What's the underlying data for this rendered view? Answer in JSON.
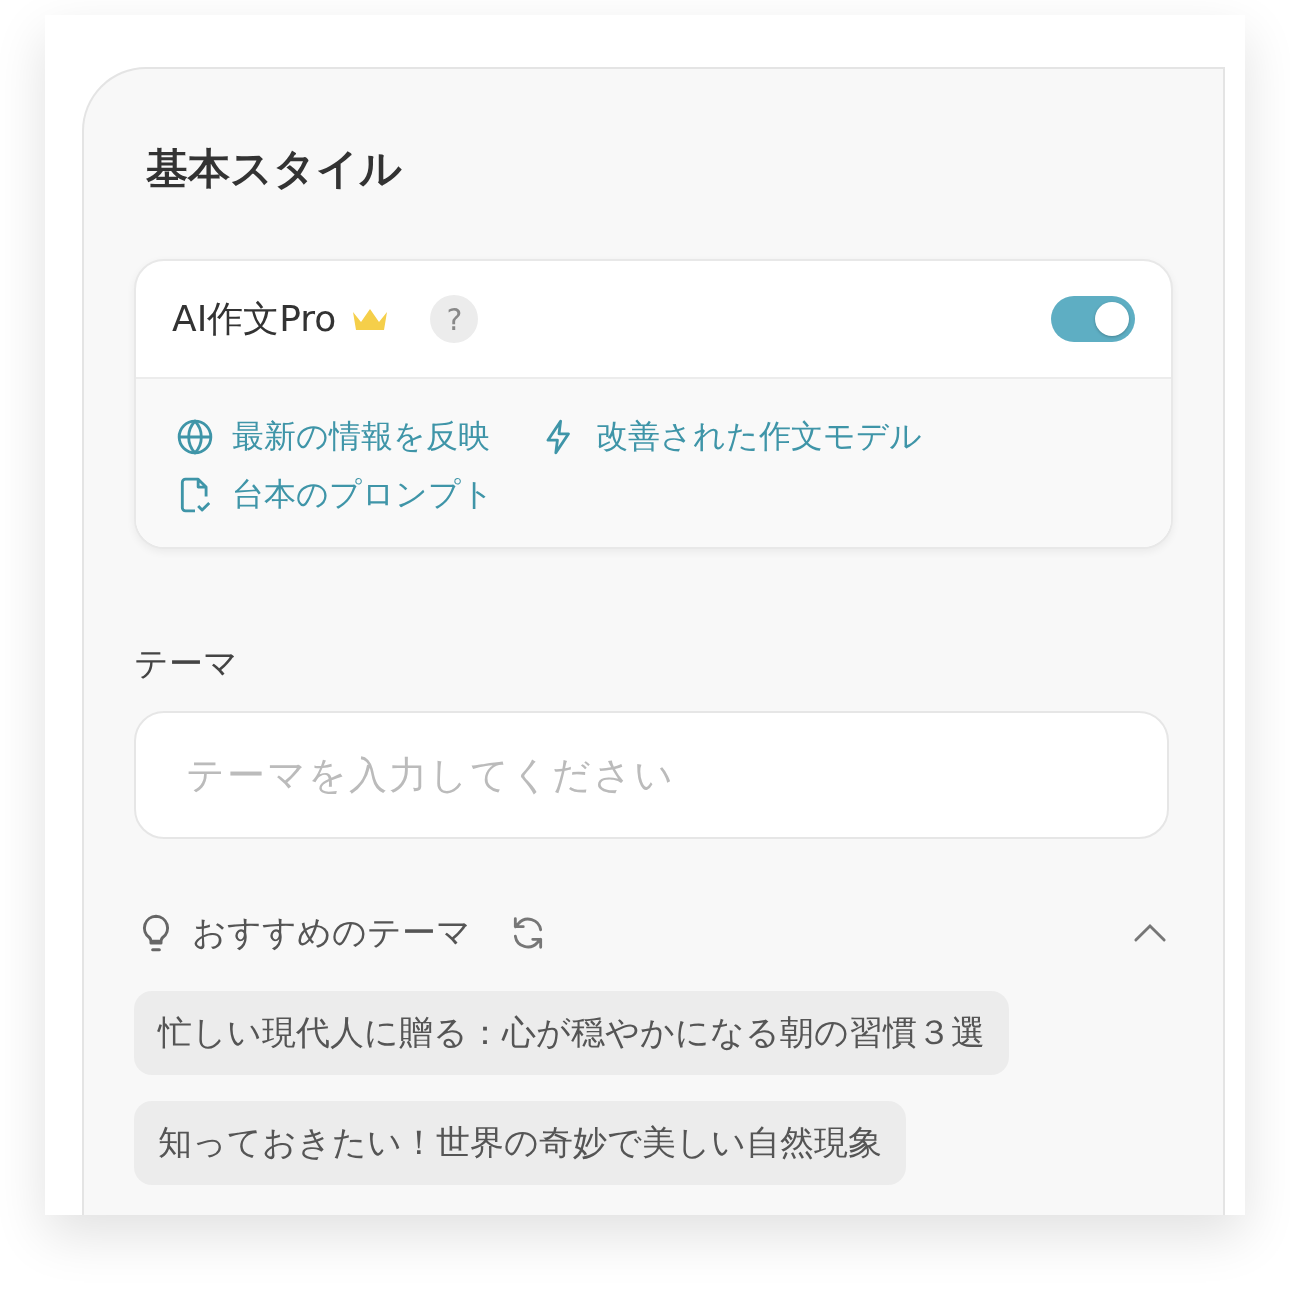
{
  "title": "基本スタイル",
  "pro_card": {
    "label": "AI作文Pro",
    "help": "?",
    "toggle": {
      "on": true
    },
    "features": [
      {
        "kind": "globe",
        "text": "最新の情報を反映"
      },
      {
        "kind": "bolt",
        "text": "改善された作文モデル"
      },
      {
        "kind": "file",
        "text": "台本のプロンプト"
      }
    ]
  },
  "theme": {
    "label": "テーマ",
    "placeholder": "テーマを入力してください"
  },
  "suggestions": {
    "label": "おすすめのテーマ",
    "expanded": true,
    "items": [
      {
        "text": "忙しい現代人に贈る：心が穏やかになる朝の習慣３選"
      },
      {
        "text": "知っておきたい！世界の奇妙で美しい自然現象"
      }
    ]
  }
}
